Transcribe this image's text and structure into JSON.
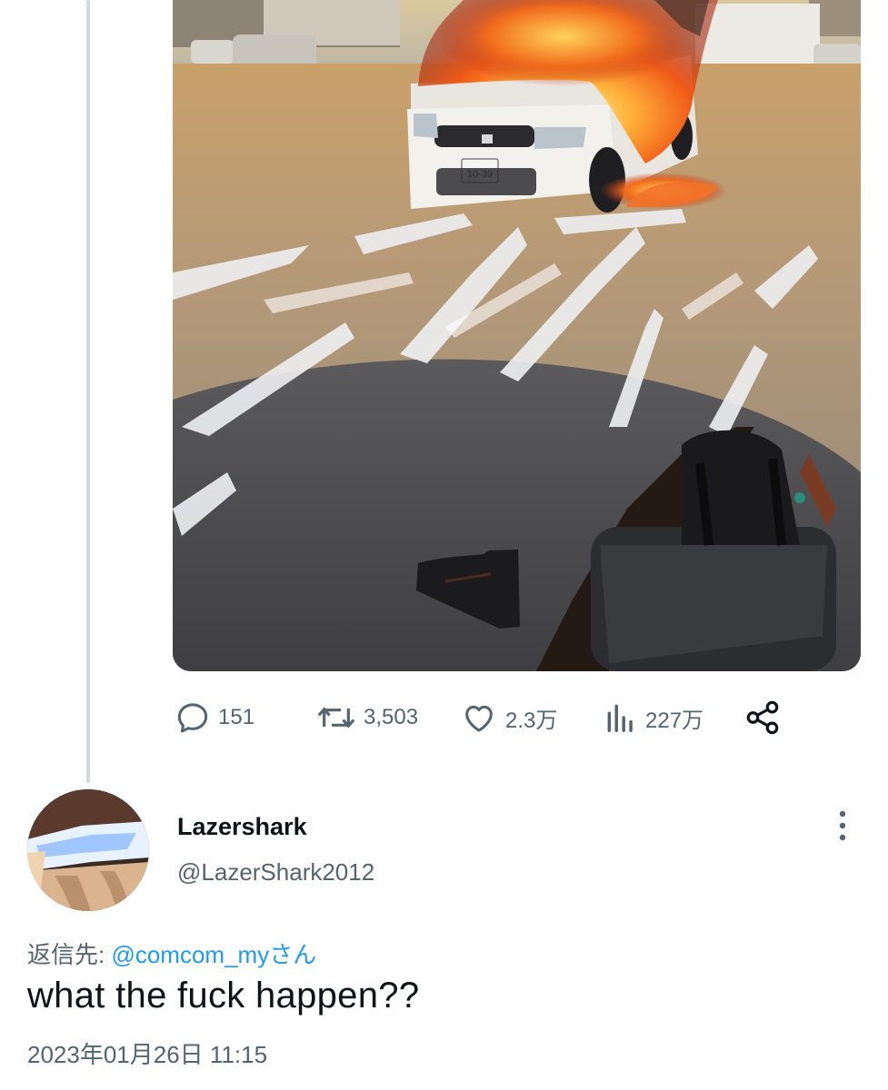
{
  "original_tweet": {
    "media_alt": "photo",
    "stats": {
      "replies": "151",
      "retweets": "3,503",
      "likes": "2.3万",
      "views": "227万"
    },
    "plate_text": "10-39"
  },
  "reply": {
    "display_name": "Lazershark",
    "handle": "@LazerShark2012",
    "replying_prefix": "返信先: ",
    "replying_to": "@comcom_myさん",
    "text": "what the fuck happen??",
    "timestamp": "2023年01月26日 11:15"
  },
  "colors": {
    "secondary_text": "#536471",
    "link": "#1d9bf0",
    "primary_text": "#0f1419",
    "thread_line": "#cfd9de"
  },
  "icons": [
    "reply-icon",
    "retweet-icon",
    "like-icon",
    "views-icon",
    "share-icon",
    "more-icon"
  ]
}
